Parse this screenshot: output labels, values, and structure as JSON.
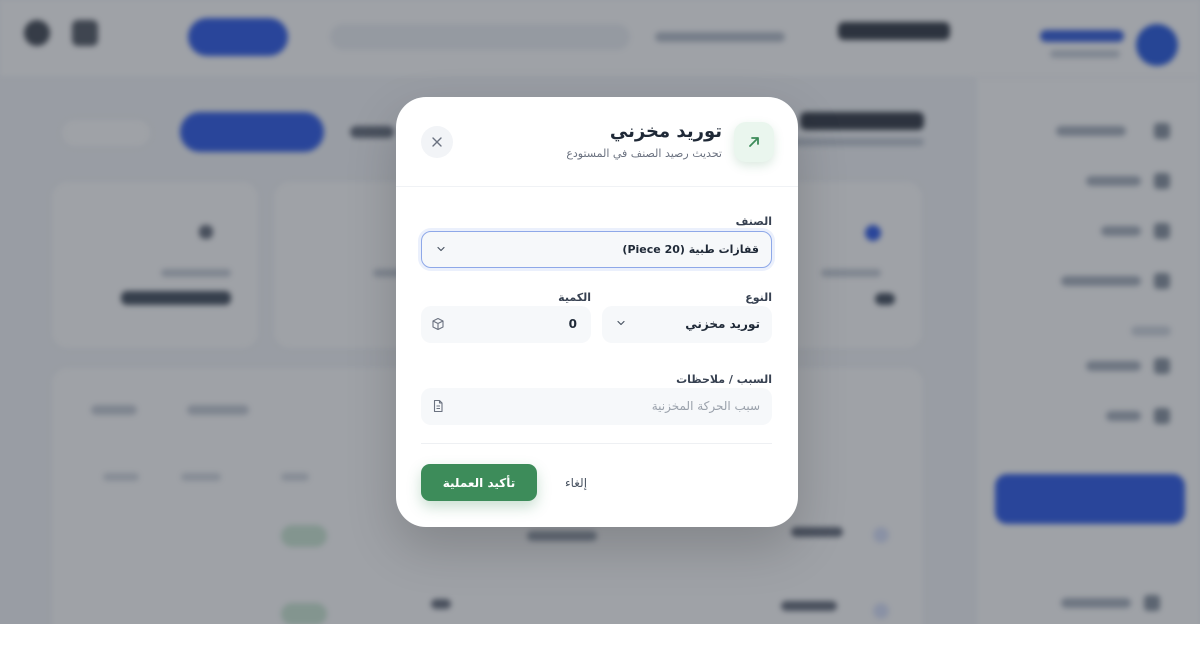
{
  "modal": {
    "title": "توريد مخزني",
    "subtitle": "تحديث رصيد الصنف في المستودع",
    "header_icon": "arrow-up-right-icon",
    "item_field": {
      "label": "الصنف",
      "value": "قفازات طبية (20 Piece)"
    },
    "type_field": {
      "label": "النوع",
      "value": "توريد مخزني"
    },
    "quantity_field": {
      "label": "الكمية",
      "value": "0"
    },
    "notes_field": {
      "label": "السبب / ملاحظات",
      "placeholder": "سبب الحركة المخزنية"
    },
    "confirm_label": "تأكيد العملية",
    "cancel_label": "إلغاء"
  },
  "colors": {
    "accent_green": "#3d8c5a",
    "accent_blue": "#3560e8",
    "overlay": "rgba(26,33,46,0.42)"
  }
}
